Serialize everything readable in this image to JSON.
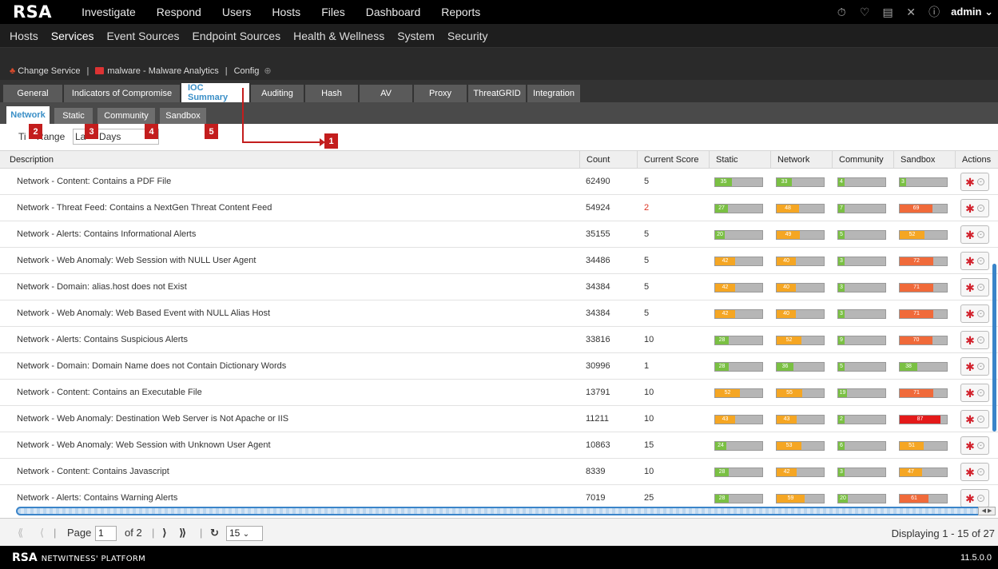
{
  "app": {
    "logo": "RSA",
    "footer_logo": "RSA",
    "footer_product": "NETWITNESS' PLATFORM",
    "version": "11.5.0.0"
  },
  "topnav": [
    "Investigate",
    "Respond",
    "Users",
    "Hosts",
    "Files",
    "Dashboard",
    "Reports"
  ],
  "user": "admin",
  "subnav": [
    "Hosts",
    "Services",
    "Event Sources",
    "Endpoint Sources",
    "Health & Wellness",
    "System",
    "Security"
  ],
  "servicebar": {
    "change_service": "Change Service",
    "service_name": "malware - Malware Analytics",
    "view": "Config"
  },
  "tabs1": [
    "General",
    "Indicators of Compromise",
    "IOC Summary",
    "Auditing",
    "Hash",
    "AV",
    "Proxy",
    "ThreatGRID",
    "Integration"
  ],
  "tabs2": [
    "Network",
    "Static",
    "Community",
    "Sandbox"
  ],
  "time_range": {
    "label_prefix": "Ti",
    "label_suffix": "Range",
    "value_prefix": "La",
    "value_suffix": "Days"
  },
  "callouts": [
    "1",
    "2",
    "3",
    "4",
    "5"
  ],
  "columns": [
    "Description",
    "Count",
    "Current Score",
    "Static",
    "Network",
    "Community",
    "Sandbox",
    "Actions"
  ],
  "rows": [
    {
      "desc": "Network - Content: Contains a PDF File",
      "count": "62490",
      "score": "5",
      "static": 35,
      "network": 33,
      "community": 4,
      "sandbox": 3
    },
    {
      "desc": "Network - Threat Feed: Contains a NextGen Threat Content Feed",
      "count": "54924",
      "score": "2",
      "static": 27,
      "network": 48,
      "community": 7,
      "sandbox": 69
    },
    {
      "desc": "Network - Alerts: Contains Informational Alerts",
      "count": "35155",
      "score": "5",
      "static": 20,
      "network": 49,
      "community": 5,
      "sandbox": 52
    },
    {
      "desc": "Network - Web Anomaly: Web Session with NULL User Agent",
      "count": "34486",
      "score": "5",
      "static": 42,
      "network": 40,
      "community": 3,
      "sandbox": 72
    },
    {
      "desc": "Network - Domain: alias.host does not Exist",
      "count": "34384",
      "score": "5",
      "static": 42,
      "network": 40,
      "community": 3,
      "sandbox": 71
    },
    {
      "desc": "Network - Web Anomaly: Web Based Event with NULL Alias Host",
      "count": "34384",
      "score": "5",
      "static": 42,
      "network": 40,
      "community": 3,
      "sandbox": 71
    },
    {
      "desc": "Network - Alerts: Contains Suspicious Alerts",
      "count": "33816",
      "score": "10",
      "static": 28,
      "network": 52,
      "community": 9,
      "sandbox": 70
    },
    {
      "desc": "Network - Domain: Domain Name does not Contain Dictionary Words",
      "count": "30996",
      "score": "1",
      "static": 28,
      "network": 36,
      "community": 5,
      "sandbox": 38
    },
    {
      "desc": "Network - Content: Contains an Executable File",
      "count": "13791",
      "score": "10",
      "static": 52,
      "network": 55,
      "community": 19,
      "sandbox": 71
    },
    {
      "desc": "Network - Web Anomaly: Destination Web Server is Not Apache or IIS",
      "count": "11211",
      "score": "10",
      "static": 43,
      "network": 43,
      "community": 2,
      "sandbox": 87
    },
    {
      "desc": "Network - Web Anomaly: Web Session with Unknown User Agent",
      "count": "10863",
      "score": "15",
      "static": 24,
      "network": 53,
      "community": 6,
      "sandbox": 51
    },
    {
      "desc": "Network - Content: Contains Javascript",
      "count": "8339",
      "score": "10",
      "static": 28,
      "network": 42,
      "community": 3,
      "sandbox": 47
    },
    {
      "desc": "Network - Alerts: Contains Warning Alerts",
      "count": "7019",
      "score": "25",
      "static": 28,
      "network": 59,
      "community": 20,
      "sandbox": 61
    }
  ],
  "pager": {
    "page_label": "Page",
    "page": "1",
    "of_label": "of 2",
    "page_size": "15",
    "displaying": "Displaying 1 - 15 of 27"
  },
  "colors": {
    "green": "#7ac043",
    "orange": "#f5a623",
    "red_orange": "#f06a3a",
    "red": "#e41a1a",
    "accent": "#3a8fc7",
    "callout": "#c31d1d"
  }
}
